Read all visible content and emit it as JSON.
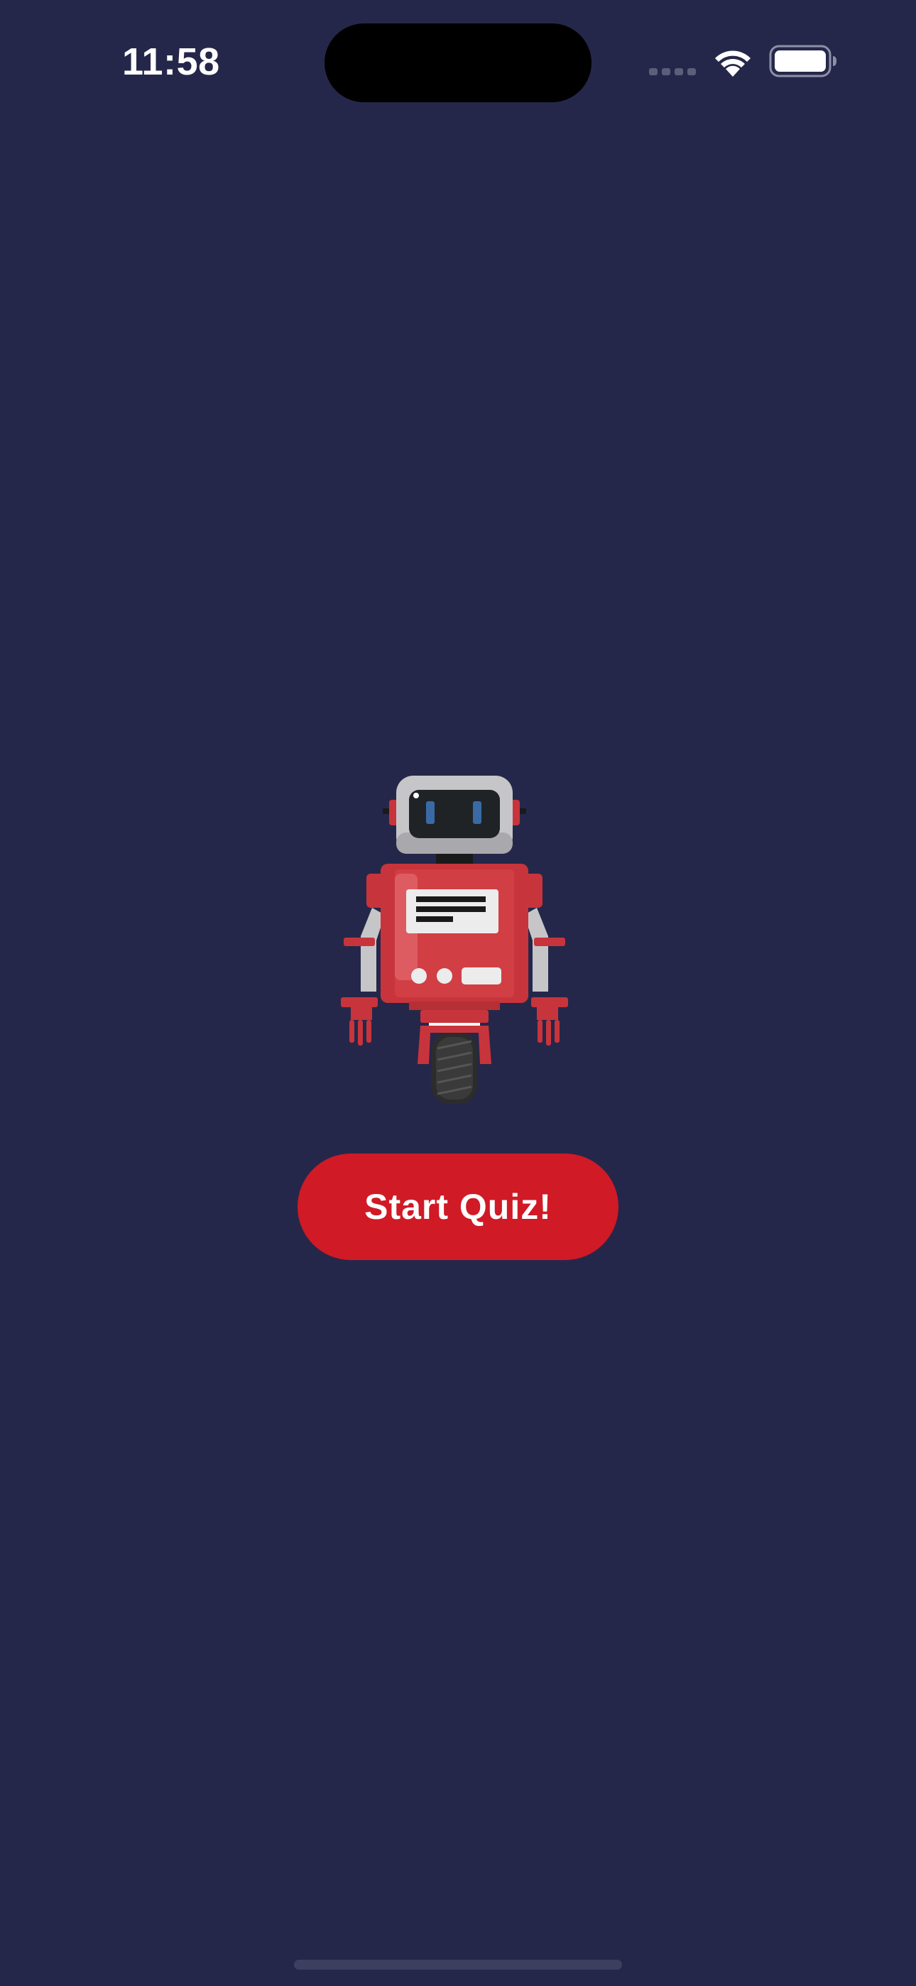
{
  "status_bar": {
    "time": "11:58",
    "icons": [
      "cellular-signal-icon",
      "wifi-icon",
      "battery-icon"
    ]
  },
  "main": {
    "illustration": "robot-illustration",
    "start_button_label": "Start Quiz!"
  },
  "colors": {
    "background": "#25274a",
    "accent": "#d01a26",
    "text": "#ffffff"
  }
}
